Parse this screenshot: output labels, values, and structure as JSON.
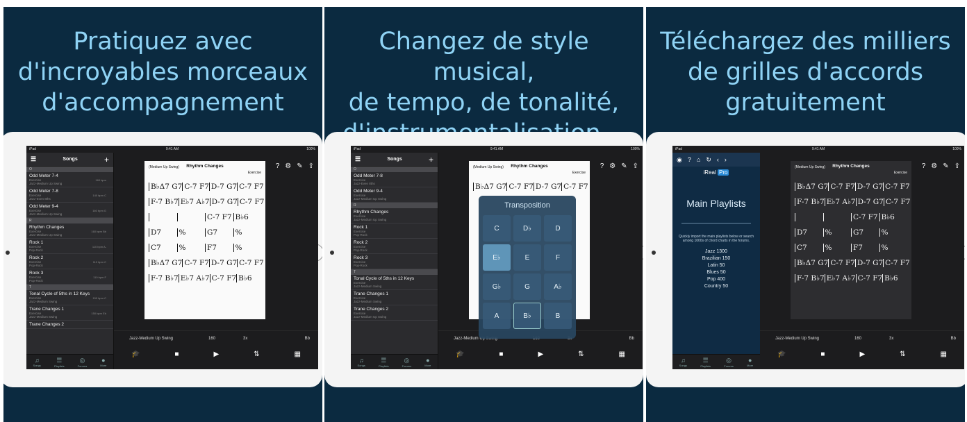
{
  "panels": [
    {
      "headline": [
        "Pratiquez avec",
        "d'incroyables morceaux",
        "d'accompagnement"
      ]
    },
    {
      "headline": [
        "Changez de style musical,",
        "de tempo, de tonalité,",
        "d'instrumentalisation…"
      ]
    },
    {
      "headline": [
        "Téléchargez des milliers",
        "de grilles d'accords",
        "gratuitement"
      ]
    }
  ],
  "status": {
    "device": "iPad",
    "time": "9:41 AM",
    "battery": "100%"
  },
  "sidebar": {
    "title": "Songs",
    "sections": [
      "O",
      "R",
      "T"
    ],
    "songs": [
      {
        "title": "Odd Meter 7-4",
        "composer": "Exercise",
        "style": "Jazz-Medium Up Swing",
        "meta": "160 bpm"
      },
      {
        "title": "Odd Meter 7-8",
        "composer": "Exercise",
        "style": "Jazz-Even 8ths",
        "meta": "140 bpm C"
      },
      {
        "title": "Odd Meter 9-4",
        "composer": "Exercise",
        "style": "Jazz-Medium Up Swing",
        "meta": "160 bpm G"
      },
      {
        "title": "Rhythm Changes",
        "composer": "Exercise",
        "style": "Jazz-Medium Up Swing",
        "meta": "160 bpm Bb"
      },
      {
        "title": "Rock 1",
        "composer": "Exercise",
        "style": "Pop-Rock",
        "meta": "110 bpm A-"
      },
      {
        "title": "Rock 2",
        "composer": "Exercise",
        "style": "Pop-Rock",
        "meta": "110 bpm C"
      },
      {
        "title": "Rock 3",
        "composer": "Exercise",
        "style": "Pop-Rock",
        "meta": "110 bpm F"
      },
      {
        "title": "Tonal Cycle of 5ths in 12 Keys",
        "composer": "Exercise",
        "style": "Jazz-Medium Swing",
        "meta": "150 bpm C"
      },
      {
        "title": "Trane Changes 1",
        "composer": "Exercise",
        "style": "Jazz-Medium Swing",
        "meta": "150 bpm Eb"
      },
      {
        "title": "Trane Changes 2",
        "composer": "Exercise",
        "style": "Jazz-Medium Up Swing",
        "meta": "160 bpm Eb"
      }
    ],
    "tabs": [
      "Songs",
      "Playlists",
      "Forums",
      "More"
    ]
  },
  "sheet": {
    "style": "(Medium Up Swing)",
    "title": "Rhythm Changes",
    "composer": "Exercise",
    "rows": [
      [
        "B♭Δ7 G7",
        "C-7 F7",
        "D-7 G7",
        "C-7 F7"
      ],
      [
        "F-7 B♭7",
        "E♭7 A♭7",
        "D-7 G7",
        "C-7 F7"
      ],
      [
        "",
        "",
        "C-7 F7",
        "B♭6"
      ],
      [
        "D7",
        "%",
        "G7",
        "%"
      ],
      [
        "C7",
        "%",
        "F7",
        "%"
      ],
      [
        "B♭Δ7 G7",
        "C-7 F7",
        "D-7 G7",
        "C-7 F7"
      ],
      [
        "F-7 B♭7",
        "E♭7 A♭7",
        "C-7 F7",
        "B♭6"
      ]
    ]
  },
  "player": {
    "style": "Jazz-Medium Up Swing",
    "tempo": "160",
    "repeats": "3x",
    "transpose": "Bb"
  },
  "transposition": {
    "title": "Transposition",
    "keys": [
      "C",
      "D♭",
      "D",
      "E♭",
      "E",
      "F",
      "G♭",
      "G",
      "A♭",
      "A",
      "B♭",
      "B"
    ]
  },
  "forum": {
    "logo": "iReal",
    "logo_pro": "Pro",
    "heading": "Main Playlists",
    "description": "Quickly import the main playlists below or search among 1000s of chord charts in the forums.",
    "playlists": [
      "Jazz 1300",
      "Brazilian 150",
      "Latin 50",
      "Blues 50",
      "Pop 400",
      "Country 50"
    ]
  }
}
